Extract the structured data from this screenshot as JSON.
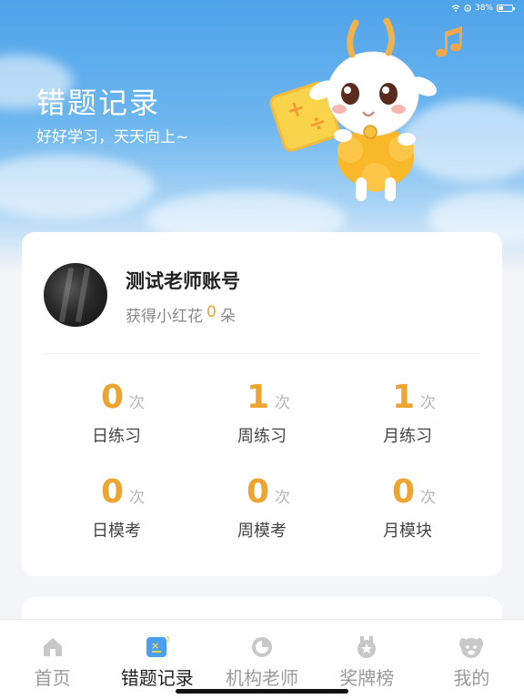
{
  "status_bar": {
    "battery_text": "38%"
  },
  "header": {
    "title": "错题记录",
    "subtitle": "好好学习，天天向上~"
  },
  "profile": {
    "name": "测试老师账号",
    "flower_prefix": "获得小红花",
    "flower_count": "0",
    "flower_suffix": "朵"
  },
  "stats": [
    {
      "value": "0",
      "unit": "次",
      "label": "日练习"
    },
    {
      "value": "1",
      "unit": "次",
      "label": "周练习"
    },
    {
      "value": "1",
      "unit": "次",
      "label": "月练习"
    },
    {
      "value": "0",
      "unit": "次",
      "label": "日模考"
    },
    {
      "value": "0",
      "unit": "次",
      "label": "周模考"
    },
    {
      "value": "0",
      "unit": "次",
      "label": "月模块"
    }
  ],
  "tabs": [
    {
      "label": "首页",
      "icon": "home-icon"
    },
    {
      "label": "错题记录",
      "icon": "mistakes-icon"
    },
    {
      "label": "机构老师",
      "icon": "teacher-icon"
    },
    {
      "label": "奖牌榜",
      "icon": "medal-icon"
    },
    {
      "label": "我的",
      "icon": "profile-icon"
    }
  ],
  "colors": {
    "accent": "#f0a430",
    "active_tab_icon": "#4a9ff0",
    "inactive_tab": "#c8c8c8"
  }
}
